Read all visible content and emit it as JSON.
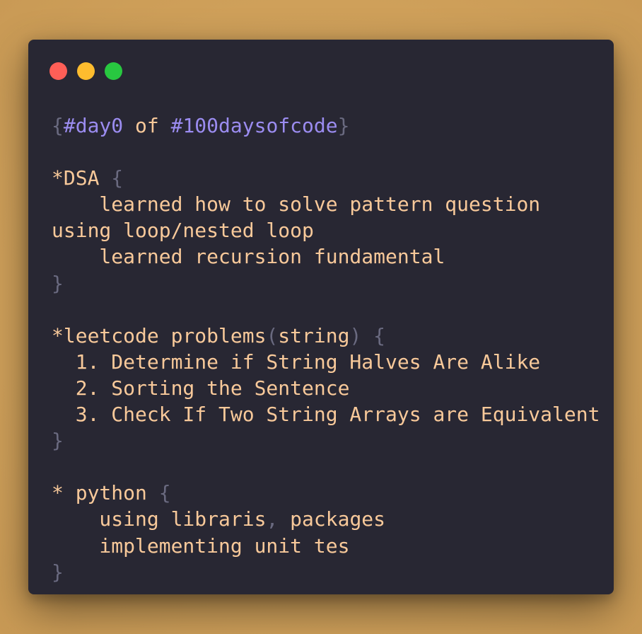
{
  "colors": {
    "background": "#d4a45e",
    "window": "#282733",
    "text": "#f8c99a",
    "keyword": "#9b8cf0",
    "punctuation": "#6a6a80",
    "dot_red": "#ff5f57",
    "dot_yellow": "#febc2e",
    "dot_green": "#28c840"
  },
  "window_controls": [
    "close",
    "minimize",
    "maximize"
  ],
  "code": {
    "lines": [
      [
        {
          "t": "{",
          "k": "punc"
        },
        {
          "t": "#day0",
          "k": "kw"
        },
        {
          "t": " of ",
          "k": "text"
        },
        {
          "t": "#100daysofcode",
          "k": "kw"
        },
        {
          "t": "}",
          "k": "punc"
        }
      ],
      [],
      [
        {
          "t": "*",
          "k": "text"
        },
        {
          "t": "DSA ",
          "k": "text"
        },
        {
          "t": "{",
          "k": "punc"
        }
      ],
      [
        {
          "t": "    learned how to solve pattern question",
          "k": "text"
        }
      ],
      [
        {
          "t": "using loop/nested loop",
          "k": "text"
        }
      ],
      [
        {
          "t": "    learned recursion fundamental",
          "k": "text"
        }
      ],
      [
        {
          "t": "}",
          "k": "punc"
        }
      ],
      [],
      [
        {
          "t": "*leetcode problems",
          "k": "text"
        },
        {
          "t": "(",
          "k": "punc"
        },
        {
          "t": "string",
          "k": "text"
        },
        {
          "t": ") {",
          "k": "punc"
        }
      ],
      [
        {
          "t": "  1. Determine if String Halves Are Alike",
          "k": "text"
        }
      ],
      [
        {
          "t": "  2. Sorting the Sentence",
          "k": "text"
        }
      ],
      [
        {
          "t": "  3. Check If Two String Arrays are Equivalent",
          "k": "text"
        }
      ],
      [
        {
          "t": "}",
          "k": "punc"
        }
      ],
      [],
      [
        {
          "t": "* python ",
          "k": "text"
        },
        {
          "t": "{",
          "k": "punc"
        }
      ],
      [
        {
          "t": "    using libraris",
          "k": "text"
        },
        {
          "t": ",",
          "k": "punc"
        },
        {
          "t": " packages",
          "k": "text"
        }
      ],
      [
        {
          "t": "    implementing unit tes",
          "k": "text"
        }
      ],
      [
        {
          "t": "}",
          "k": "punc"
        }
      ]
    ]
  }
}
